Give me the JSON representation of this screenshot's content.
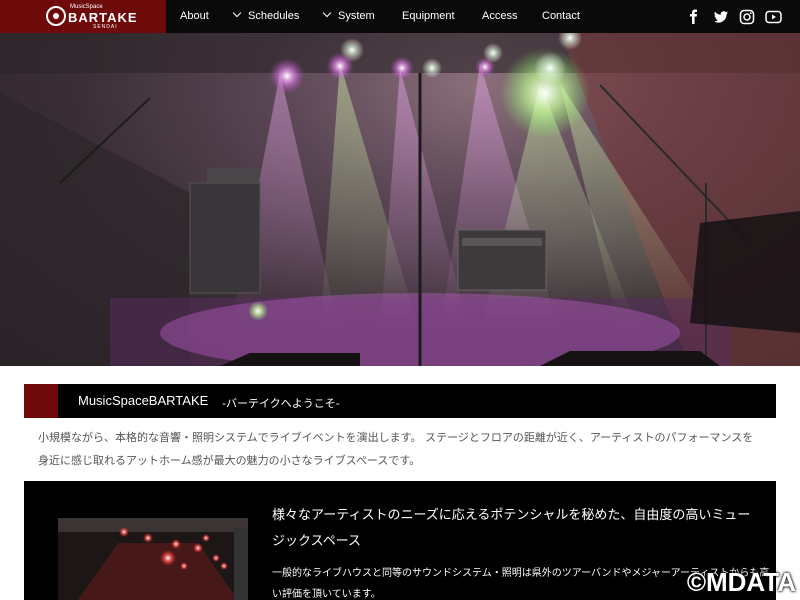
{
  "brand": {
    "small": "MusicSpace",
    "name": "BARTAKE",
    "sub": "SENDAI"
  },
  "nav": {
    "items": [
      {
        "label": "About"
      },
      {
        "label": "Schedules"
      },
      {
        "label": "System"
      },
      {
        "label": "Equipment"
      },
      {
        "label": "Access"
      },
      {
        "label": "Contact"
      }
    ],
    "social": [
      "facebook-icon",
      "twitter-icon",
      "instagram-icon",
      "youtube-icon"
    ]
  },
  "section": {
    "title": "MusicSpaceBARTAKE",
    "subtitle": "-バーテイクへようこそ-",
    "intro": "小規模ながら、本格的な音響・照明システムでライブイベントを演出します。 ステージとフロアの距離が近く、アーティストのパフォーマンスを身近に感じ取れるアットホーム感が最大の魅力の小さなライブスペースです。"
  },
  "feature": {
    "heading": "様々なアーティストのニーズに応えるポテンシャルを秘めた、自由度の高いミュージックスペース",
    "body": "一般的なライブハウスと同等のサウンドシステム・照明は県外のツアーバンドやメジャーアーティストからも高い評価を頂いています。"
  },
  "watermark": "©MDATA",
  "colors": {
    "accent": "#6e0a0a",
    "nav_bg": "#0a0a0a"
  }
}
